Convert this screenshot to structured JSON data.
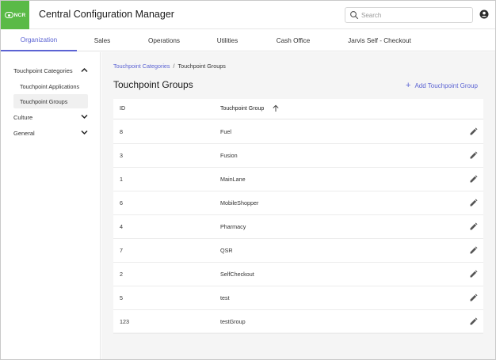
{
  "header": {
    "logo_text": "NCR",
    "app_title": "Central Configuration Manager",
    "search_placeholder": "Search",
    "brand_color": "#5aba47"
  },
  "tabs": [
    {
      "label": "Organization",
      "active": true
    },
    {
      "label": "Sales"
    },
    {
      "label": "Operations"
    },
    {
      "label": "Utilities"
    },
    {
      "label": "Cash Office"
    },
    {
      "label": "Jarvis Self - Checkout"
    }
  ],
  "sidebar": {
    "groups": [
      {
        "label": "Touchpoint Categories",
        "expanded": true,
        "items": [
          {
            "label": "Touchpoint Applications"
          },
          {
            "label": "Touchpoint Groups",
            "selected": true
          }
        ]
      },
      {
        "label": "Culture",
        "expanded": false
      },
      {
        "label": "General",
        "expanded": false
      }
    ]
  },
  "main": {
    "breadcrumb": {
      "parent": "Touchpoint Categories",
      "separator": "/",
      "current": "Touchpoint Groups"
    },
    "title": "Touchpoint Groups",
    "add_button_label": "Add Touchpoint Group",
    "accent_color": "#5b63d3",
    "table": {
      "columns": [
        "ID",
        "Touchpoint Group"
      ],
      "sort": {
        "column": "Touchpoint Group",
        "direction": "ascending"
      },
      "rows": [
        {
          "id": "8",
          "group": "Fuel"
        },
        {
          "id": "3",
          "group": "Fusion"
        },
        {
          "id": "1",
          "group": "MainLane"
        },
        {
          "id": "6",
          "group": "MobileShopper"
        },
        {
          "id": "4",
          "group": "Pharmacy"
        },
        {
          "id": "7",
          "group": "QSR"
        },
        {
          "id": "2",
          "group": "SelfCheckout"
        },
        {
          "id": "5",
          "group": "test"
        },
        {
          "id": "123",
          "group": "testGroup"
        }
      ]
    }
  },
  "icons": {
    "search": "search-icon",
    "user": "user-account-icon",
    "expand": "chevron-up-icon",
    "collapse": "chevron-down-icon",
    "sort": "arrow-up-icon",
    "add": "plus-icon",
    "edit": "pencil-icon"
  }
}
